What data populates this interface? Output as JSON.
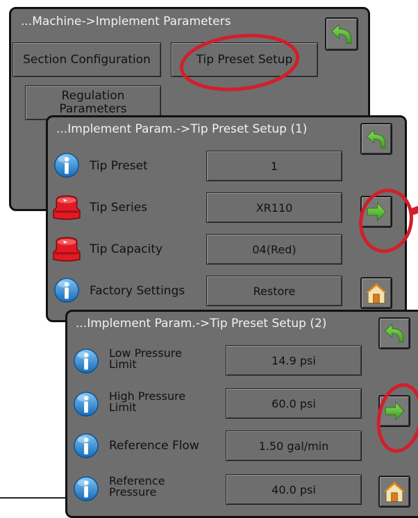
{
  "panel1": {
    "title": "...Machine->Implement Parameters",
    "section_config_label": "Section Configuration",
    "tip_preset_setup_label": "Tip Preset Setup",
    "regulation_line1": "Regulation",
    "regulation_line2": "Parameters"
  },
  "panel2": {
    "title": "...Implement Param.->Tip Preset Setup (1)",
    "rows": [
      {
        "icon": "info-icon",
        "label": "Tip Preset",
        "value": "1"
      },
      {
        "icon": "red-nozzle-icon",
        "label": "Tip Series",
        "value": "XR110"
      },
      {
        "icon": "red-nozzle-icon",
        "label": "Tip Capacity",
        "value": "04(Red)"
      },
      {
        "icon": "info-icon",
        "label": "Factory Settings",
        "value": "Restore"
      }
    ]
  },
  "panel3": {
    "title": "...Implement Param.->Tip Preset Setup (2)",
    "rows": [
      {
        "icon": "info-icon",
        "label_line1": "Low Pressure",
        "label_line2": "Limit",
        "value": "14.9 psi"
      },
      {
        "icon": "info-icon",
        "label_line1": "High Pressure",
        "label_line2": "Limit",
        "value": "60.0 psi"
      },
      {
        "icon": "info-icon",
        "label": "Reference Flow",
        "value": "1.50 gal/min"
      },
      {
        "icon": "info-icon",
        "label_line1": "Reference",
        "label_line2": "Pressure",
        "value": "40.0 psi"
      }
    ]
  },
  "colors": {
    "panel": "#6e6e6e",
    "highlight": "#d21f2b",
    "back_arrow": "#5fba3a"
  }
}
